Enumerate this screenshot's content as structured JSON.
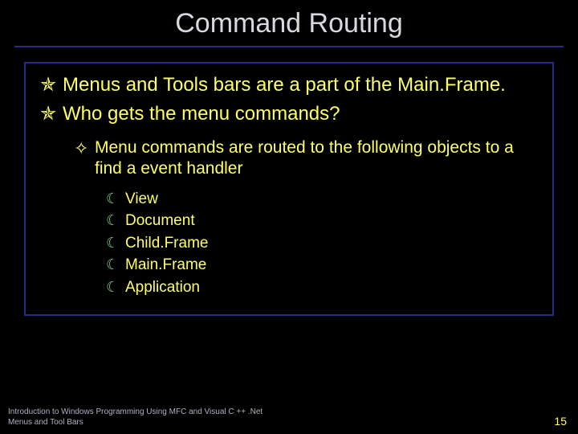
{
  "title": "Command Routing",
  "bullets_lvl1": [
    "Menus and Tools bars are a part of the Main.Frame.",
    "Who gets the menu commands?"
  ],
  "bullet_lvl2": "Menu commands  are routed to the following objects to a find a event handler",
  "bullets_lvl3": [
    "View",
    "Document",
    "Child.Frame",
    "Main.Frame",
    "Application"
  ],
  "footer_line1": "Introduction to Windows Programming Using MFC and Visual C ++ .Net",
  "footer_line2": "Menus and Tool Bars",
  "page_number": "15",
  "glyphs": {
    "lvl1": "✯",
    "lvl2": "✧",
    "lvl3": "☾"
  }
}
